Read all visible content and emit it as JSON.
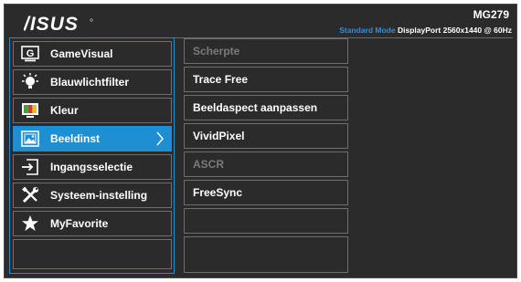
{
  "brand": {
    "logo_text": "/ISUS",
    "icon": "asus-logo"
  },
  "header": {
    "model": "MG279",
    "mode": "Standard Mode",
    "input": "DisplayPort",
    "resolution": "2560x1440 @ 60Hz"
  },
  "colors": {
    "accent": "#1f8fd4",
    "mode_text": "#2f8ed8",
    "background": "#2b2b2b",
    "border": "#6e6e6e"
  },
  "menu": {
    "items": [
      {
        "label": "GameVisual",
        "icon": "gamevisual-icon"
      },
      {
        "label": "Blauwlichtfilter",
        "icon": "bulb-icon"
      },
      {
        "label": "Kleur",
        "icon": "color-monitor-icon"
      },
      {
        "label": "Beeldinst",
        "icon": "picture-icon",
        "selected": true
      },
      {
        "label": "Ingangsselectie",
        "icon": "input-select-icon"
      },
      {
        "label": "Systeem-instelling",
        "icon": "tools-icon"
      },
      {
        "label": "MyFavorite",
        "icon": "star-icon"
      },
      {
        "label": ""
      }
    ]
  },
  "submenu": {
    "items": [
      {
        "label": "Scherpte",
        "enabled": false
      },
      {
        "label": "Trace Free",
        "enabled": true
      },
      {
        "label": "Beeldaspect aanpassen",
        "enabled": true
      },
      {
        "label": "VividPixel",
        "enabled": true
      },
      {
        "label": "ASCR",
        "enabled": false
      },
      {
        "label": "FreeSync",
        "enabled": true
      },
      {
        "label": "",
        "enabled": false
      },
      {
        "label": "",
        "enabled": false
      }
    ]
  }
}
